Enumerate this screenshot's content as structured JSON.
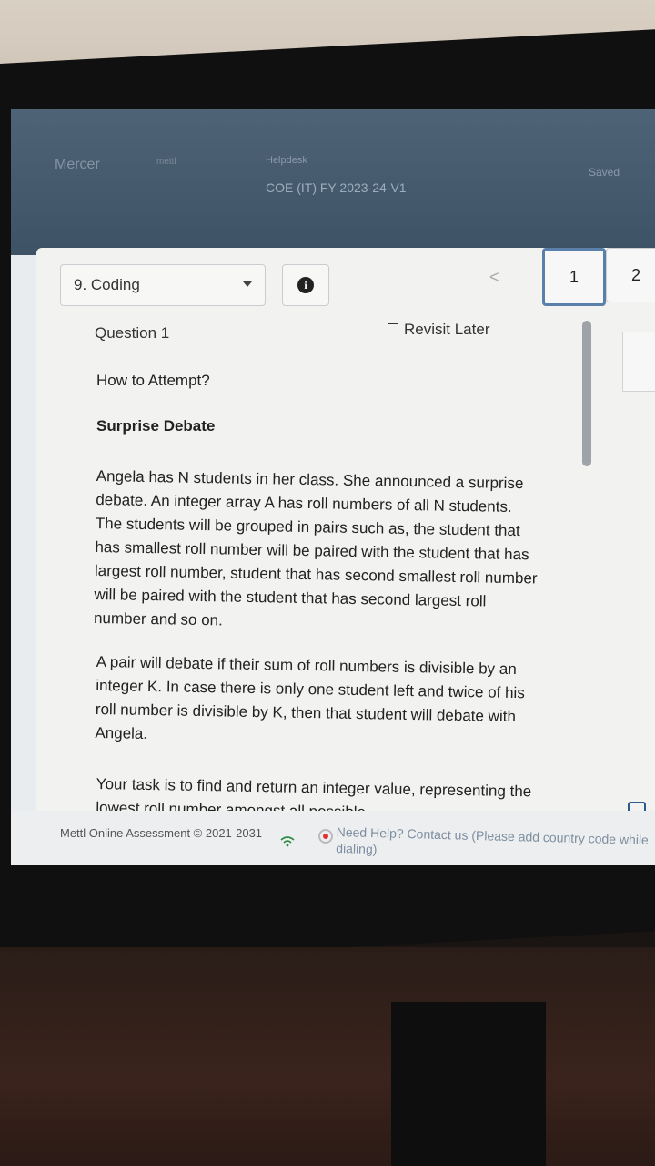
{
  "header": {
    "brand": "Mercer",
    "brand_sub": "mettl",
    "test_title": "Helpdesk",
    "test_name": "COE (IT) FY 2023-24-V1",
    "saved": "Saved"
  },
  "toolbar": {
    "section_label": "9. Coding",
    "info_icon": "i",
    "prev_icon": "<",
    "question_numbers": [
      "1",
      "2"
    ]
  },
  "question": {
    "title": "Question 1",
    "revisit_label": "Revisit Later",
    "how_to": "How to Attempt?",
    "problem_title": "Surprise Debate",
    "para1": "Angela has N students in her class. She announced a surprise debate. An integer array A has roll numbers of all N students. The students will be grouped in pairs such as, the student that has smallest roll number will be paired with the student that has largest roll number, student that has second smallest roll number will be paired with the student that has second largest roll number and so on.",
    "para2": "A pair will debate if their sum of roll numbers is divisible by an integer K. In case there is only one student left and twice of his roll number is divisible by K, then that student will debate with Angela.",
    "para3": "Your task is to find and return an integer value, representing the lowest roll number amongst all possible"
  },
  "footer": {
    "copyright": "Mettl Online Assessment © 2021-2031",
    "help": "Need Help? Contact us (Please add country code while dialing)"
  },
  "colors": {
    "header_bg": "#4f6377",
    "active_border": "#5a7fa8",
    "help_text": "#7d8ea0"
  }
}
